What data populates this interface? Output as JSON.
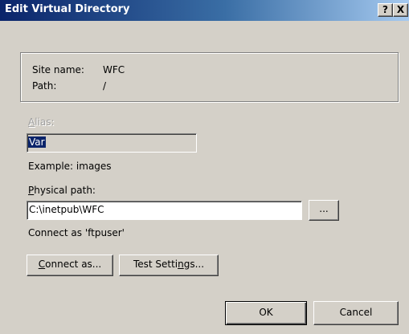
{
  "dialog": {
    "title": "Edit Virtual Directory",
    "help_button": "?",
    "close_button": "X"
  },
  "site_info": {
    "site_name_label": "Site name:",
    "site_name_value": "WFC",
    "path_label": "Path:",
    "path_value": "/"
  },
  "alias": {
    "label_first": "A",
    "label_rest": "lias:",
    "value": "Var",
    "enabled": false
  },
  "example": {
    "text": "Example: images"
  },
  "physical_path": {
    "label_first": "P",
    "label_rest": "hysical path:",
    "value": "C:\\inetpub\\WFC",
    "browse_label": "..."
  },
  "connect_status": {
    "text": "Connect as 'ftpuser'"
  },
  "buttons": {
    "connect_as_first": "C",
    "connect_as_rest": "onnect as...",
    "test_settings_pre": "Test Setti",
    "test_settings_u": "n",
    "test_settings_post": "gs...",
    "ok": "OK",
    "cancel": "Cancel"
  },
  "colors": {
    "title_bar_start": "#0a246a",
    "title_bar_end": "#a6caf0",
    "dialog_background": "#d4d0c8",
    "selection_background": "#0a246a"
  }
}
